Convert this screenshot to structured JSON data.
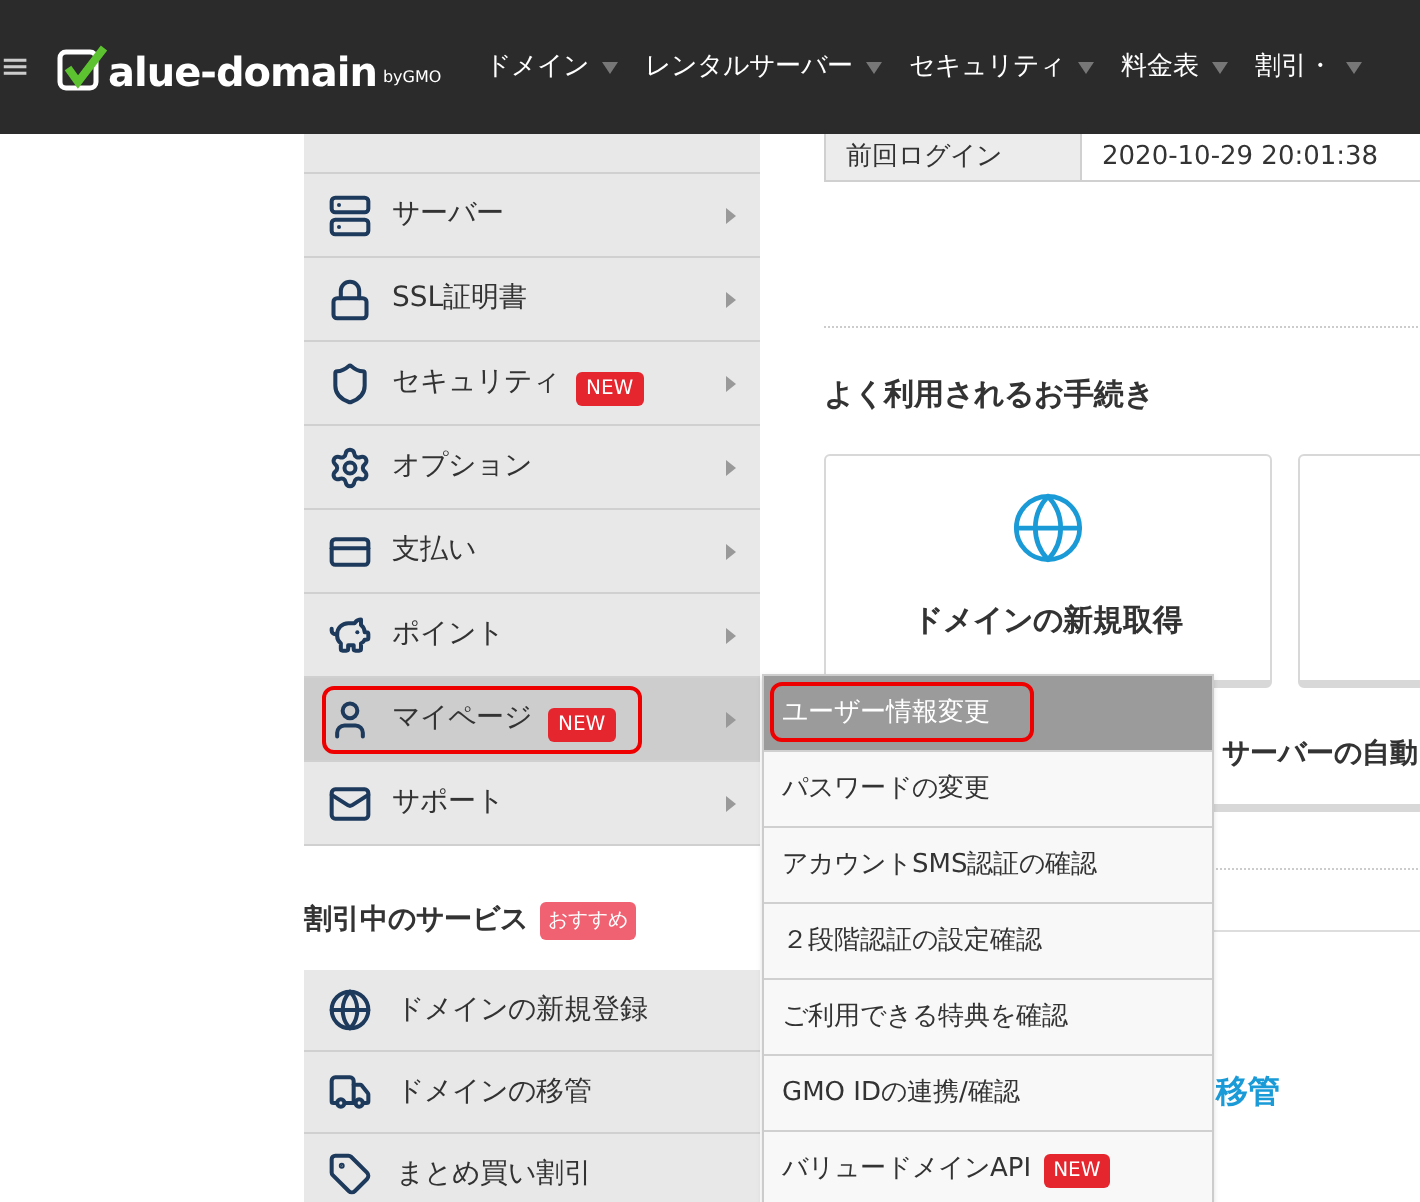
{
  "header": {
    "menu_glyph": "≡",
    "logo": {
      "text": "alue-domain",
      "by": "byGMO"
    },
    "nav": [
      {
        "label": "ドメイン"
      },
      {
        "label": "レンタルサーバー"
      },
      {
        "label": "セキュリティ"
      },
      {
        "label": "料金表"
      },
      {
        "label": "割引・"
      }
    ]
  },
  "sidebar": {
    "items": [
      {
        "kind": "server",
        "label": "サーバー",
        "selected": false,
        "highlighted": false
      },
      {
        "kind": "ssl",
        "label": "SSL証明書",
        "selected": false,
        "highlighted": false
      },
      {
        "kind": "security",
        "label": "セキュリティ",
        "badge": "NEW",
        "selected": false,
        "highlighted": false
      },
      {
        "kind": "option",
        "label": "オプション",
        "selected": false,
        "highlighted": false
      },
      {
        "kind": "payment",
        "label": "支払い",
        "selected": false,
        "highlighted": false
      },
      {
        "kind": "point",
        "label": "ポイント",
        "selected": false,
        "highlighted": false
      },
      {
        "kind": "mypage",
        "label": "マイページ",
        "badge": "NEW",
        "selected": true,
        "highlighted": true
      },
      {
        "kind": "support",
        "label": "サポート",
        "selected": false,
        "highlighted": false
      }
    ],
    "discount_title": "割引中のサービス",
    "discount_badge": "おすすめ",
    "discount_items": [
      {
        "kind": "www",
        "label": "ドメインの新規登録"
      },
      {
        "kind": "truck",
        "label": "ドメインの移管"
      },
      {
        "kind": "tag",
        "label": "まとめ買い割引"
      }
    ]
  },
  "login_table": {
    "label": "前回ログイン",
    "value": "2020-10-29 20:01:38"
  },
  "frequent": {
    "title": "よく利用されるお手続き",
    "cards": [
      {
        "label": "ドメインの新規取得"
      }
    ],
    "partial_card_text": "サーバーの自動",
    "link_text": "移管"
  },
  "dropdown": {
    "items": [
      {
        "label": "ユーザー情報変更",
        "selected": true,
        "highlighted": true
      },
      {
        "label": "パスワードの変更",
        "selected": false,
        "highlighted": false
      },
      {
        "label": "アカウントSMS認証の確認",
        "selected": false,
        "highlighted": false
      },
      {
        "label": "２段階認証の設定確認",
        "selected": false,
        "highlighted": false
      },
      {
        "label": "ご利用できる特典を確認",
        "selected": false,
        "highlighted": false
      },
      {
        "label": "GMO IDの連携/確認",
        "selected": false,
        "highlighted": false
      },
      {
        "label": "バリュードメインAPI",
        "badge": "NEW",
        "selected": false,
        "highlighted": false
      }
    ]
  }
}
